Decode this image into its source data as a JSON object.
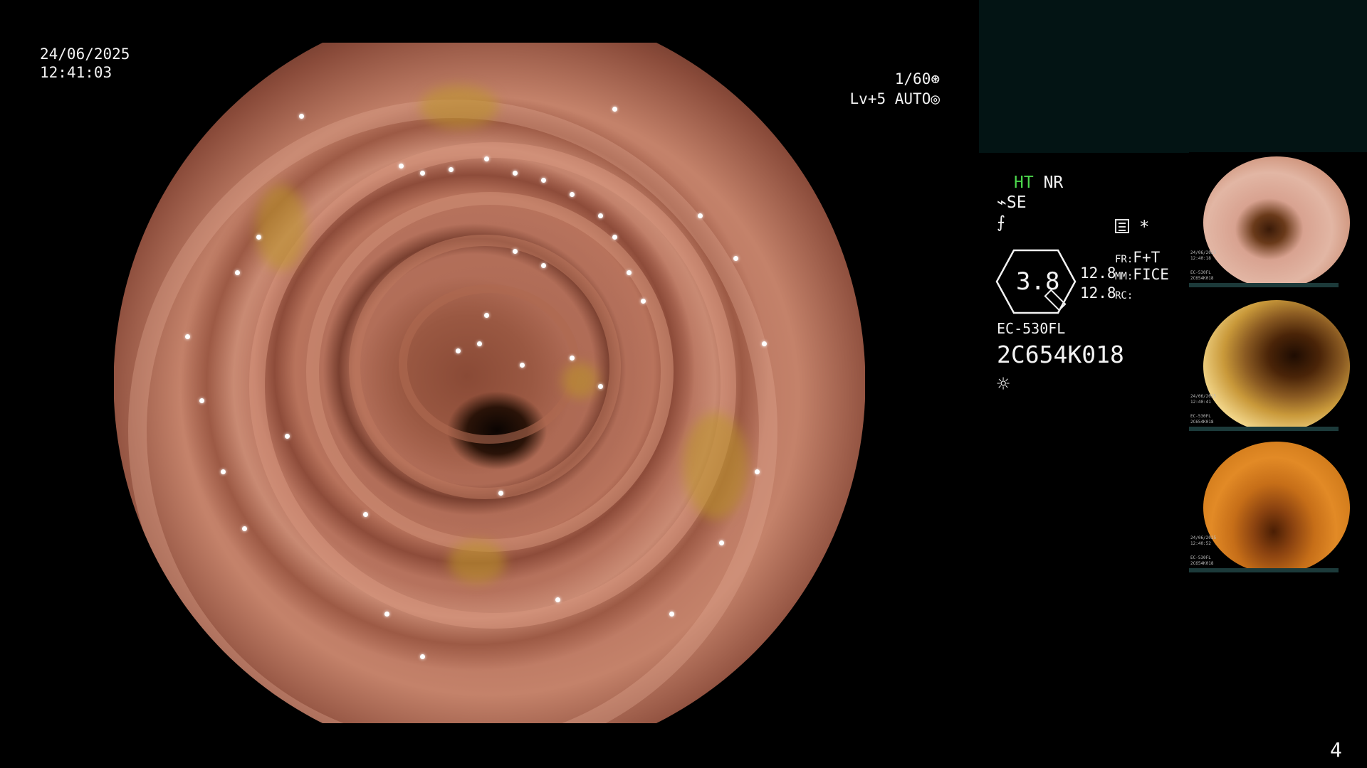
{
  "overlay": {
    "date": "24/06/2025",
    "time": "12:41:03",
    "shutter": "1/60",
    "level": "Lv+5",
    "iris_mode": "AUTO",
    "page_number": "4"
  },
  "status": {
    "ht_label": "HT",
    "nr_label": "NR",
    "se_label": "SE",
    "asterisk": "*",
    "zoom_value": "3.8",
    "value_top": "12.8",
    "value_bottom": "12.8",
    "fr_label": "FR:",
    "fr_value": "F+T",
    "mm_label": "MM:",
    "mm_value": "FICE",
    "rc_label": "RC:",
    "scope_model": "EC-530FL",
    "serial": "2C654K018",
    "colors": {
      "ht": "#4cd84c",
      "text": "#f2f2f2",
      "panel": "#031414"
    }
  },
  "thumbnails": [
    {
      "name": "thumb-1",
      "date": "24/06/2025",
      "time": "12:40:18",
      "model": "EC-530FL",
      "serial": "2C654K018",
      "tone": "pink"
    },
    {
      "name": "thumb-2",
      "date": "24/06/2025",
      "time": "12:40:41",
      "model": "EC-530FL",
      "serial": "2C654K018",
      "tone": "yellow"
    },
    {
      "name": "thumb-3",
      "date": "24/06/2025",
      "time": "12:40:52",
      "model": "EC-530FL",
      "serial": "2C654K018",
      "tone": "orange"
    }
  ],
  "icons": {
    "shutter": "aperture-icon",
    "iris": "iris-icon",
    "se": "scope-edge-icon",
    "f": "function-icon",
    "menu": "list-icon",
    "zoom": "zoom-dial-icon",
    "light": "light-icon"
  }
}
